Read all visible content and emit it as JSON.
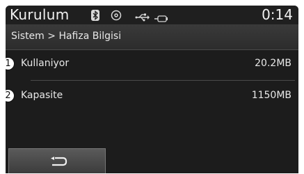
{
  "header": {
    "title": "Kurulum",
    "time": "0:14",
    "icons": [
      "bluetooth-icon",
      "disc-icon",
      "usb-icon",
      "aux-icon"
    ]
  },
  "breadcrumb": "Sistem > Hafiza Bilgisi",
  "rows": [
    {
      "marker": "1",
      "label": "Kullaniyor",
      "value": "20.2MB"
    },
    {
      "marker": "2",
      "label": "Kapasite",
      "value": "1150MB"
    }
  ],
  "footer": {
    "back_icon": "back-arrow-icon"
  }
}
